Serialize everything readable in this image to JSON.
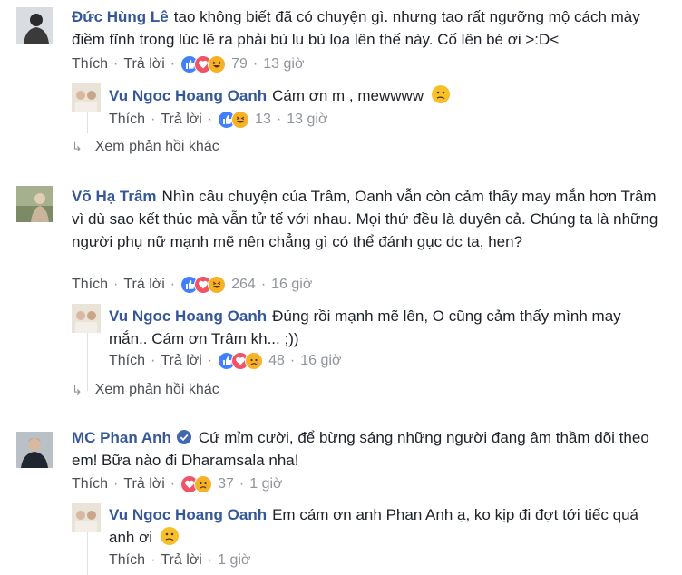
{
  "labels": {
    "like": "Thích",
    "reply": "Trả lời",
    "more_replies": "Xem phản hồi khác",
    "dot": "·"
  },
  "comments": [
    {
      "author": "Đức Hùng Lê",
      "text": "tao không biết đã có chuyện gì. nhưng tao rất ngưỡng mộ cách mày điềm tĩnh trong lúc lẽ ra phải bù lu bù loa lên thế này. Cố lên bé ơi >:D<",
      "reactions": [
        "like-icon",
        "love-icon",
        "haha-icon"
      ],
      "count": "79",
      "time": "13 giờ",
      "reply": {
        "author": "Vu Ngoc Hoang Oanh",
        "text": "Cám ơn m , mewwww",
        "emoji": "confused-face-icon",
        "reactions": [
          "like-icon",
          "haha-icon"
        ],
        "count": "13",
        "time": "13 giờ"
      }
    },
    {
      "author": "Võ Hạ Trâm",
      "text": "Nhìn câu chuyện của Trâm, Oanh vẫn còn cảm thấy may mắn hơn Trâm vì dù sao kết thúc mà vẫn tử tế với nhau. Mọi thứ đều là duyên cả. Chúng ta là những người phụ nữ mạnh mẽ nên chẳng gì có thể đánh gục dc ta, hen?",
      "reactions": [
        "like-icon",
        "love-icon",
        "haha-icon"
      ],
      "count": "264",
      "time": "16 giờ",
      "reply": {
        "author": "Vu Ngoc Hoang Oanh",
        "text": "Đúng rồi mạnh mẽ lên, O cũng cảm thấy mình may mắn.. Cám ơn Trâm kh... ;))",
        "emoji": "",
        "reactions": [
          "like-icon",
          "love-icon",
          "sad-icon"
        ],
        "count": "48",
        "time": "16 giờ"
      }
    },
    {
      "author": "MC Phan Anh",
      "verified": "verified-badge-icon",
      "text": "Cứ mỉm cười, để bừng sáng những người đang âm thầm dõi theo em! Bữa nào đi Dharamsala nha!",
      "reactions": [
        "love-icon",
        "sad-icon"
      ],
      "count": "37",
      "time": "1 giờ",
      "reply": {
        "author": "Vu Ngoc Hoang Oanh",
        "text": "Em cám ơn anh Phan Anh ạ, ko kịp đi đợt tới tiếc quá anh ơi",
        "emoji": "confused-face-icon",
        "reactions": [],
        "count": "",
        "time": "1 giờ"
      }
    }
  ],
  "colors": {
    "link": "#365899",
    "meta": "#90949c",
    "like": "#4080ff",
    "love": "#f25268",
    "haha": "#f7b125"
  }
}
